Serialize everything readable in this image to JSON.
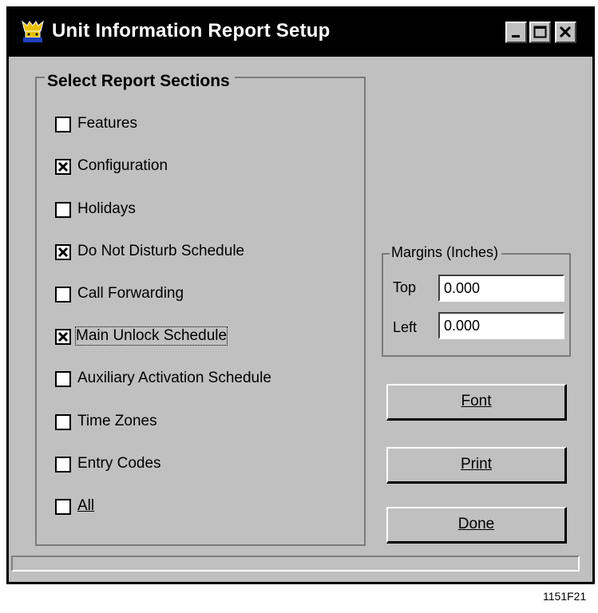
{
  "window": {
    "title": "Unit Information Report Setup",
    "titlebar_color": "#000000",
    "face_color": "#c0c0c0",
    "controls": [
      "minimize-icon",
      "maximize-icon",
      "close-icon"
    ]
  },
  "sections": {
    "legend": "Select Report Sections",
    "items": [
      {
        "label": "Features",
        "checked": false
      },
      {
        "label": "Configuration",
        "checked": true
      },
      {
        "label": "Holidays",
        "checked": false
      },
      {
        "label": "Do Not Disturb Schedule",
        "checked": true
      },
      {
        "label": "Call Forwarding",
        "checked": false
      },
      {
        "label": "Main Unlock Schedule",
        "checked": true
      },
      {
        "label": "Auxiliary Activation Schedule",
        "checked": false
      },
      {
        "label": "Time Zones",
        "checked": false
      },
      {
        "label": "Entry Codes",
        "checked": false
      },
      {
        "label": "All",
        "checked": false
      }
    ]
  },
  "margins": {
    "legend": "Margins (Inches)",
    "top_label": "Top",
    "top_value": "0.000",
    "left_label": "Left",
    "left_value": "0.000"
  },
  "buttons": {
    "font": "Font",
    "print": "Print",
    "done": "Done"
  },
  "figure_code": "1151F21"
}
